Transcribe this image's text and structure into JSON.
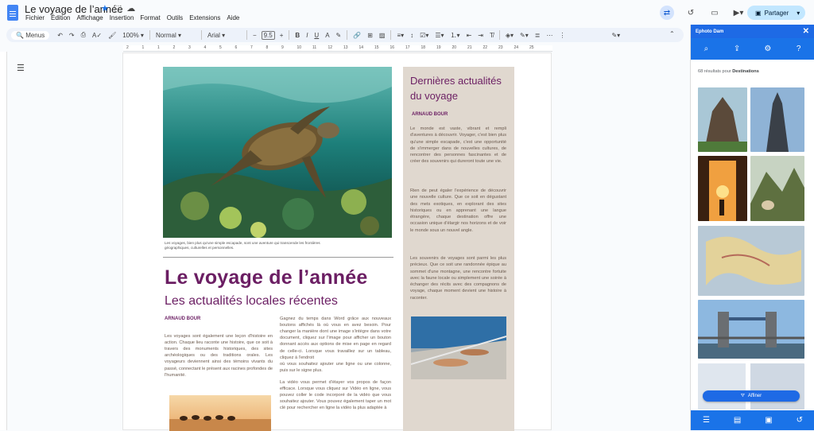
{
  "app": {
    "doc_title": "Le voyage de l’année",
    "menu": [
      "Fichier",
      "Édition",
      "Affichage",
      "Insertion",
      "Format",
      "Outils",
      "Extensions",
      "Aide"
    ],
    "share_label": "Partager"
  },
  "toolbar": {
    "menus_label": "Menus",
    "zoom": "100%",
    "style": "Normal",
    "font": "Arial",
    "font_size": "9.5"
  },
  "ruler": {
    "numbers": [
      "2",
      "1",
      "1",
      "2",
      "3",
      "4",
      "5",
      "6",
      "7",
      "8",
      "9",
      "10",
      "11",
      "12",
      "13",
      "14",
      "15",
      "16",
      "17",
      "18",
      "19",
      "20",
      "21",
      "22",
      "23",
      "24",
      "25"
    ]
  },
  "document": {
    "hero_caption": "Les voyages, bien plus qu'une simple escapade, sont une aventure qui transcende les frontières géographiques, culturelles et personnelles.",
    "heading": "Le voyage de l’année",
    "subheading": "Les actualités locales récentes",
    "author": "ARNAUD BOUR",
    "col1_text": "Les voyages sont également une leçon d'histoire en action. Chaque lieu raconte une histoire, que ce soit à travers des monuments historiques, des sites archéologiques ou des traditions orales. Les voyageurs deviennent ainsi des témoins vivants du passé, connectant le présent aux racines profondes de l'humanité.",
    "col2_p1": "Gagnez du temps dans Word grâce aux nouveaux boutons affichés là où vous en avez besoin. Pour changer la manière dont une image s'intègre dans votre document, cliquez sur l'image pour afficher un bouton donnant accès aux options de mise en page en regard de celle-ci. Lorsque vous travaillez sur un tableau, cliquez à l'endroit",
    "col2_p1b": "où vous souhaitez ajouter une ligne ou une colonne, puis sur le signe plus.",
    "col2_p2": "La vidéo vous permet d'étayer vos propos de façon efficace. Lorsque vous cliquez sur Vidéo en ligne, vous pouvez coller le code incorporé de la vidéo que vous souhaitez ajouter. Vous pouvez également taper un mot clé pour rechercher en ligne la vidéo la plus adaptée à",
    "sidebar_title": "Dernières actualités du voyage",
    "sidebar_author": "ARNAUD BOUR",
    "sidebar_p1": "Le monde est vaste, vibrant et rempli d'aventures à découvrir. Voyager, c'est bien plus qu'une simple escapade, c'est une opportunité de s'immerger dans de nouvelles cultures, de rencontrer des personnes fascinantes et de créer des souvenirs qui dureront toute une vie.",
    "sidebar_p2": "Rien de peut égaler l'expérience de découvrir une nouvelle culture. Que ce soit en dégustant des mets exotiques, en explorant des sites historiques ou en apprenant une langue étrangère, chaque destination offre une occasion unique d'élargir nos horizons et de voir le monde sous un nouvel angle.",
    "sidebar_p3": "Les souvenirs de voyages sont parmi les plus précieux. Que ce soit une randonnée épique au sommet d'une montagne, une rencontre fortuite avec la faune locale ou simplement une soirée à échanger des récits avec des compagnons de voyage, chaque moment devient une histoire à raconter."
  },
  "side_panel": {
    "title": "Ephoto Dam",
    "results_prefix": "68 résultats pour",
    "results_term": "Destinations",
    "refine_label": "Affiner"
  },
  "colors": {
    "accent": "#1a73e8",
    "heading_purple": "#6b1e63",
    "sidebar_bg": "#e0d8cf"
  }
}
